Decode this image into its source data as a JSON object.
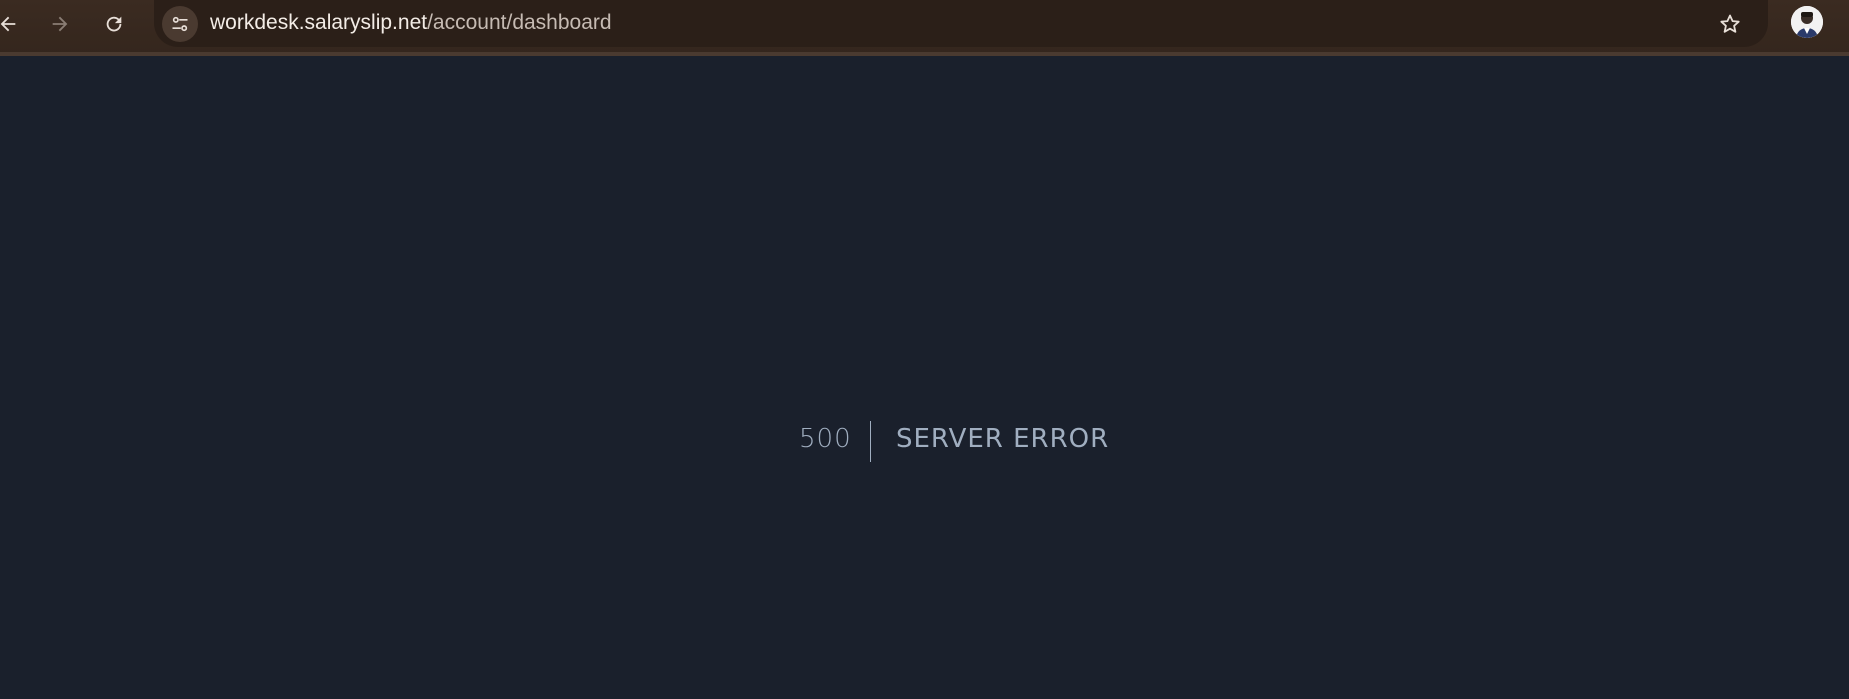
{
  "browser": {
    "url_host": "workdesk.salaryslip.net",
    "url_path": "/account/dashboard",
    "icons": {
      "back": "arrow-left-icon",
      "forward": "arrow-right-icon",
      "reload": "reload-icon",
      "site_info": "tune-icon",
      "bookmark": "star-icon",
      "profile": "avatar"
    }
  },
  "error": {
    "code": "500",
    "message": "SERVER ERROR"
  },
  "colors": {
    "page_background": "#1a202c",
    "error_text": "#a0aec0",
    "toolbar_background": "#3a2a20",
    "omnibox_background": "#2b1f18"
  }
}
